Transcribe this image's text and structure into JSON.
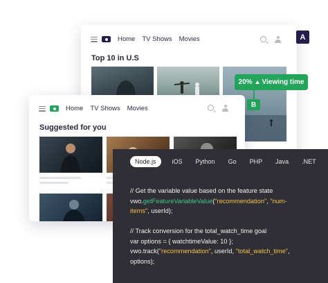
{
  "colors": {
    "brand_green": "#22a55b",
    "navy": "#241d4d",
    "code_bg": "#2f2f35",
    "fn_green": "#42c88a",
    "string_yellow": "#f2c14e"
  },
  "back_card": {
    "nav": {
      "icons": [
        "hamburger-icon",
        "tv-logo-icon",
        "search-icon",
        "user-icon"
      ],
      "links": [
        "Home",
        "TV Shows",
        "Movies"
      ]
    },
    "section_title": "Top 10 in U.S",
    "badge": "A"
  },
  "variation_b": {
    "metric_percent": "20%",
    "metric_label": "Viewing time",
    "trend_icon": "arrow-up-icon",
    "badge": "B"
  },
  "front_card": {
    "nav": {
      "icons": [
        "hamburger-icon",
        "tv-logo-icon",
        "search-icon",
        "user-icon"
      ],
      "links": [
        "Home",
        "TV Shows",
        "Movies"
      ]
    },
    "section_title": "Suggested for you"
  },
  "code_panel": {
    "tabs": [
      "Node.js",
      "iOS",
      "Python",
      "Go",
      "PHP",
      "Java",
      ".NET"
    ],
    "active_tab": "Node.js",
    "comment1": "// Get the variable value based on the feature state",
    "l2_obj": "vwo.",
    "l2_fn": "getFeatureVariableValue",
    "l2_paren": "(",
    "l2_str1": "\"recommendation\"",
    "l2_comma": ", ",
    "l2_str2a": "\"num-",
    "l3_str2b": "items\"",
    "l3_rest": ", userId);",
    "comment2": "// Track conversion for the total_watch_time goal",
    "l5": "var options = { watchtimeValue: 10 };",
    "l6_a": "vwo.track(",
    "l6_str1": "\"recommendation\"",
    "l6_b": ", userId, ",
    "l6_str2": "\"total_watch_time\"",
    "l6_c": ",",
    "l7": "options);"
  }
}
